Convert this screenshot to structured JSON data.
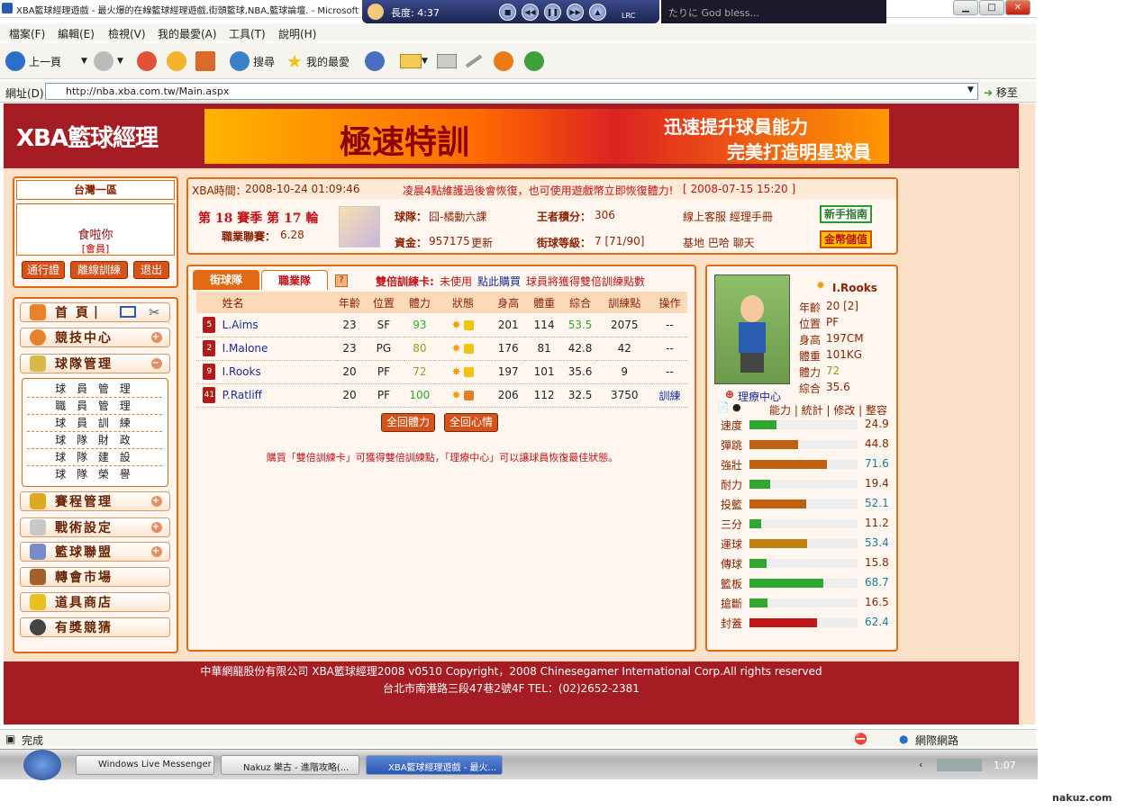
{
  "window": {
    "title": "XBA籃球經理遊戲 - 最火爆的在線籃球經理遊戲,街頭籃球,NBA,籃球論壇. - Microsoft I"
  },
  "player": {
    "length": "長度: 4:37",
    "lrc": "LRC",
    "lyric": "たりに   God bless..."
  },
  "menu": [
    "檔案(F)",
    "編輯(E)",
    "檢視(V)",
    "我的最愛(A)",
    "工具(T)",
    "說明(H)"
  ],
  "toolbar": {
    "back": "上一頁",
    "search": "搜尋",
    "favorites": "我的最愛"
  },
  "address": {
    "label": "網址(D)",
    "url": "http://nba.xba.com.tw/Main.aspx",
    "go": "移至"
  },
  "site": {
    "logo": "XBA籃球經理",
    "banner": {
      "main": "極速特訓",
      "line1": "迅速提升球員能力",
      "line2": "完美打造明星球員"
    }
  },
  "user": {
    "server": "台灣一區",
    "name": "食啦你",
    "rank": "[會員]",
    "buttons": [
      "通行證",
      "離線訓練",
      "退出"
    ]
  },
  "nav": {
    "home": "首 頁",
    "items": [
      "競技中心",
      "球隊管理",
      "賽程管理",
      "戰術設定",
      "籃球聯盟",
      "轉會市場",
      "道具商店",
      "有獎競猜"
    ],
    "sub": [
      "球 員 管 理",
      "職 員 管 理",
      "球 員 訓 練",
      "球 隊 財 政",
      "球 隊 建 設",
      "球 隊 榮 譽"
    ]
  },
  "topinfo": {
    "time_label": "XBA時間：",
    "time": "2008-10-24 01:09:46",
    "notice": "凌晨4點維護過後會恢復，也可使用遊戲幣立即恢復體力!",
    "notice_date": "[ 2008-07-15 15:20 ]",
    "season": "第 18 賽季 第 17 輪",
    "league_label": "職業聯賽：",
    "league": "6.28",
    "team_label": "球隊：",
    "team": "囧-橘動六課",
    "king_label": "王者積分：",
    "king": "306",
    "service": "線上客服  經理手冊",
    "money_label": "資金：",
    "money": "957175",
    "refresh": "更新",
    "level_label": "街球等級：",
    "level": "7 [71/90]",
    "links": "基地  巴哈  聊天",
    "guide": "新手指南",
    "store": "金幣儲值"
  },
  "tabs": {
    "street": "街球隊",
    "pro": "職業隊"
  },
  "card": {
    "label": "雙倍訓練卡:",
    "status": "未使用",
    "buy": "點此購買",
    "desc": "球員將獲得雙倍訓練點數"
  },
  "table": {
    "headers": [
      "姓名",
      "年齡",
      "位置",
      "體力",
      "狀態",
      "身高",
      "體重",
      "綜合",
      "訓練點",
      "操作"
    ],
    "rows": [
      {
        "num": "5",
        "name": "L.Aims",
        "age": "23",
        "pos": "SF",
        "stamina": "93",
        "height": "201",
        "weight": "114",
        "overall": "53.5",
        "train": "2075",
        "op": "--"
      },
      {
        "num": "2",
        "name": "I.Malone",
        "age": "23",
        "pos": "PG",
        "stamina": "80",
        "height": "176",
        "weight": "81",
        "overall": "42.8",
        "train": "42",
        "op": "--"
      },
      {
        "num": "9",
        "name": "I.Rooks",
        "age": "20",
        "pos": "PF",
        "stamina": "72",
        "height": "197",
        "weight": "101",
        "overall": "35.6",
        "train": "9",
        "op": "--"
      },
      {
        "num": "41",
        "name": "P.Ratliff",
        "age": "20",
        "pos": "PF",
        "stamina": "100",
        "height": "206",
        "weight": "112",
        "overall": "32.5",
        "train": "3750",
        "op": "訓練"
      }
    ]
  },
  "actions": {
    "stamina": "全回體力",
    "mood": "全回心情"
  },
  "hint": "購買「雙倍訓練卡」可獲得雙倍訓練點，「理療中心」可以讓球員恢復最佳狀態。",
  "profile": {
    "name": "I.Rooks",
    "fields": [
      {
        "k": "年齡",
        "v": "20 [2]"
      },
      {
        "k": "位置",
        "v": "PF"
      },
      {
        "k": "身高",
        "v": "197CM"
      },
      {
        "k": "體重",
        "v": "101KG"
      },
      {
        "k": "體力",
        "v": "72"
      },
      {
        "k": "綜合",
        "v": "35.6"
      }
    ],
    "clinic": "理療中心",
    "tabs": "能力 | 統計 | 修改 | 整容"
  },
  "stats": [
    {
      "name": "速度",
      "value": 24.9,
      "color": "#2ea82e"
    },
    {
      "name": "彈跳",
      "value": 44.8,
      "color": "#c06010"
    },
    {
      "name": "強壯",
      "value": 71.6,
      "color": "#c06010"
    },
    {
      "name": "耐力",
      "value": 19.4,
      "color": "#2ea82e"
    },
    {
      "name": "投籃",
      "value": 52.1,
      "color": "#c06010"
    },
    {
      "name": "三分",
      "value": 11.2,
      "color": "#2ea82e"
    },
    {
      "name": "運球",
      "value": 53.4,
      "color": "#c08010"
    },
    {
      "name": "傳球",
      "value": 15.8,
      "color": "#2ea82e"
    },
    {
      "name": "籃板",
      "value": 68.7,
      "color": "#2ea82e"
    },
    {
      "name": "搶斷",
      "value": 16.5,
      "color": "#2ea82e"
    },
    {
      "name": "封蓋",
      "value": 62.4,
      "color": "#c01818"
    }
  ],
  "footer": {
    "line1": "中華網龍股份有限公司 XBA籃球經理2008 v0510    Copyright，2008 Chinesegamer International Corp.All rights reserved",
    "line2": "台北市南港路三段47巷2號4F TEL：(02)2652-2381"
  },
  "status": {
    "text": "完成",
    "zone": "網際網路"
  },
  "taskbar": {
    "items": [
      "Windows Live Messenger",
      "Nakuz 樂古 - 進階攻略(...",
      "XBA籃球經理遊戲 - 最火..."
    ],
    "clock": "1:07"
  },
  "watermark": "nakuz.com"
}
